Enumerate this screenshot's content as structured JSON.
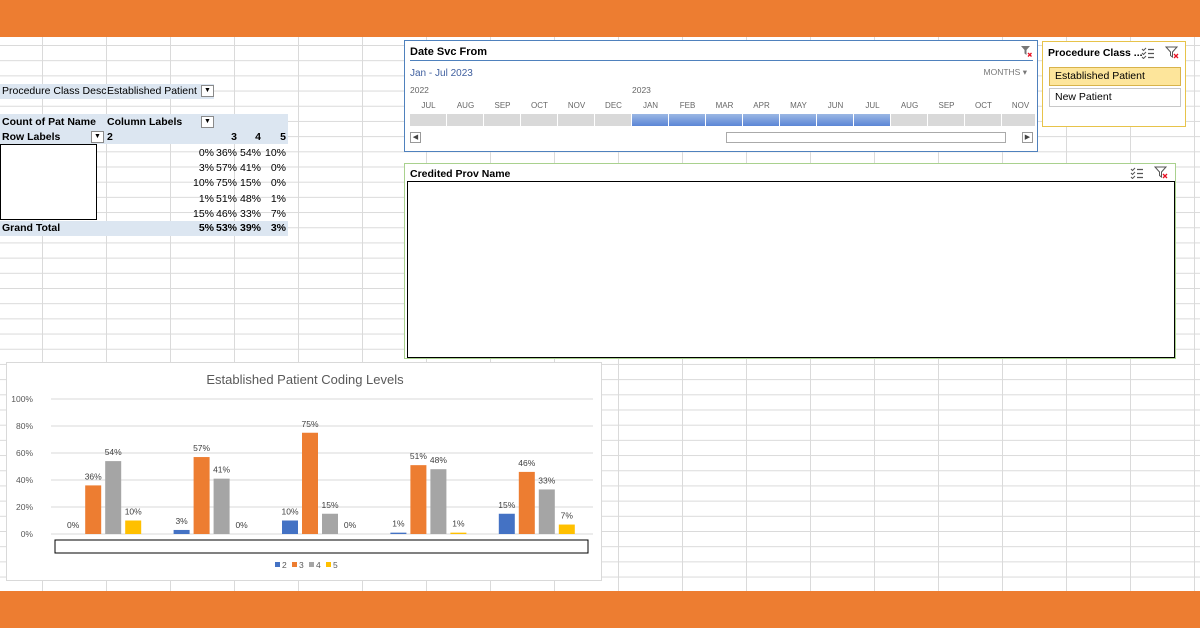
{
  "pivot": {
    "filter_field": "Procedure Class Desc",
    "filter_value": "Established Patient",
    "values_caption": "Count of Pat Name",
    "column_labels": "Column Labels",
    "row_labels": "Row Labels",
    "col_headers": [
      "2",
      "3",
      "4",
      "5"
    ],
    "rows": [
      [
        "0%",
        "36%",
        "54%",
        "10%"
      ],
      [
        "3%",
        "57%",
        "41%",
        "0%"
      ],
      [
        "10%",
        "75%",
        "15%",
        "0%"
      ],
      [
        "1%",
        "51%",
        "48%",
        "1%"
      ],
      [
        "15%",
        "46%",
        "33%",
        "7%"
      ]
    ],
    "grand_total_label": "Grand Total",
    "grand_total": [
      "5%",
      "53%",
      "39%",
      "3%"
    ]
  },
  "timeline": {
    "title": "Date Svc From",
    "range": "Jan - Jul 2023",
    "level": "MONTHS",
    "years": [
      {
        "label": "2022",
        "index": 0
      },
      {
        "label": "2023",
        "index": 6
      }
    ],
    "months": [
      "JUL",
      "AUG",
      "SEP",
      "OCT",
      "NOV",
      "DEC",
      "JAN",
      "FEB",
      "MAR",
      "APR",
      "MAY",
      "JUN",
      "JUL",
      "AUG",
      "SEP",
      "OCT",
      "NOV"
    ],
    "selected_from": 6,
    "selected_to": 12
  },
  "slicer": {
    "title": "Procedure Class ...",
    "items": [
      {
        "label": "Established Patient",
        "selected": true
      },
      {
        "label": "New Patient",
        "selected": false
      }
    ]
  },
  "credited_prov": {
    "title": "Credited Prov Name"
  },
  "chart_data": {
    "type": "bar",
    "title": "Established Patient Coding Levels",
    "categories": [
      "",
      "",
      "",
      "",
      ""
    ],
    "series": [
      {
        "name": "2",
        "values": [
          0,
          3,
          10,
          1,
          15
        ],
        "color": "#4472c4"
      },
      {
        "name": "3",
        "values": [
          36,
          57,
          75,
          51,
          46
        ],
        "color": "#ed7d31"
      },
      {
        "name": "4",
        "values": [
          54,
          41,
          15,
          48,
          33
        ],
        "color": "#a5a5a5"
      },
      {
        "name": "5",
        "values": [
          10,
          0,
          0,
          1,
          7
        ],
        "color": "#ffc000"
      }
    ],
    "ylim": [
      0,
      100
    ],
    "yticks": [
      "0%",
      "20%",
      "40%",
      "60%",
      "80%",
      "100%"
    ],
    "data_label_suffix": "%",
    "gridlines": true,
    "legend": "bottom"
  },
  "colors": {
    "accent": "#ed7d31",
    "header": "#dce6f1",
    "timeline_border": "#4f81bd",
    "slicer_selected": "#fde59b"
  }
}
